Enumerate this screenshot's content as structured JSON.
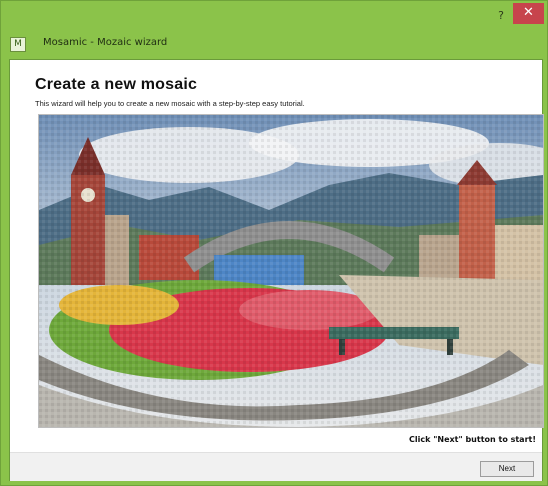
{
  "window": {
    "title": "Mosamic - Mozaic wizard",
    "icon_label": "M",
    "help_label": "?",
    "close_label": "✕",
    "accent_color": "#8bc34a",
    "close_color": "#c7444c"
  },
  "page": {
    "heading": "Create a new mosaic",
    "subtitle": "This wizard will help you to create a new mosaic with a step-by-step easy tutorial.",
    "hint": "Click \"Next\" button to start!"
  },
  "footer": {
    "next_label": "Next"
  },
  "image": {
    "icon": "mosaic-photo-icon"
  }
}
